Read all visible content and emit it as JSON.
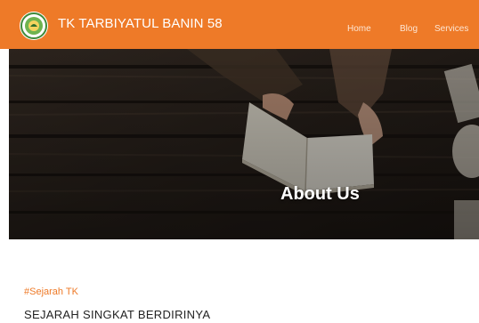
{
  "header": {
    "brand": "TK TARBIYATUL BANIN 58",
    "nav": {
      "home": "Home",
      "blog": "Blog",
      "services": "Services"
    }
  },
  "hero": {
    "title": "About Us"
  },
  "section": {
    "tag": "#Sejarah TK",
    "heading": "SEJARAH SINGKAT BERDIRINYA"
  },
  "colors": {
    "accent": "#ee7a28",
    "hero_bg": "#2b231d"
  }
}
